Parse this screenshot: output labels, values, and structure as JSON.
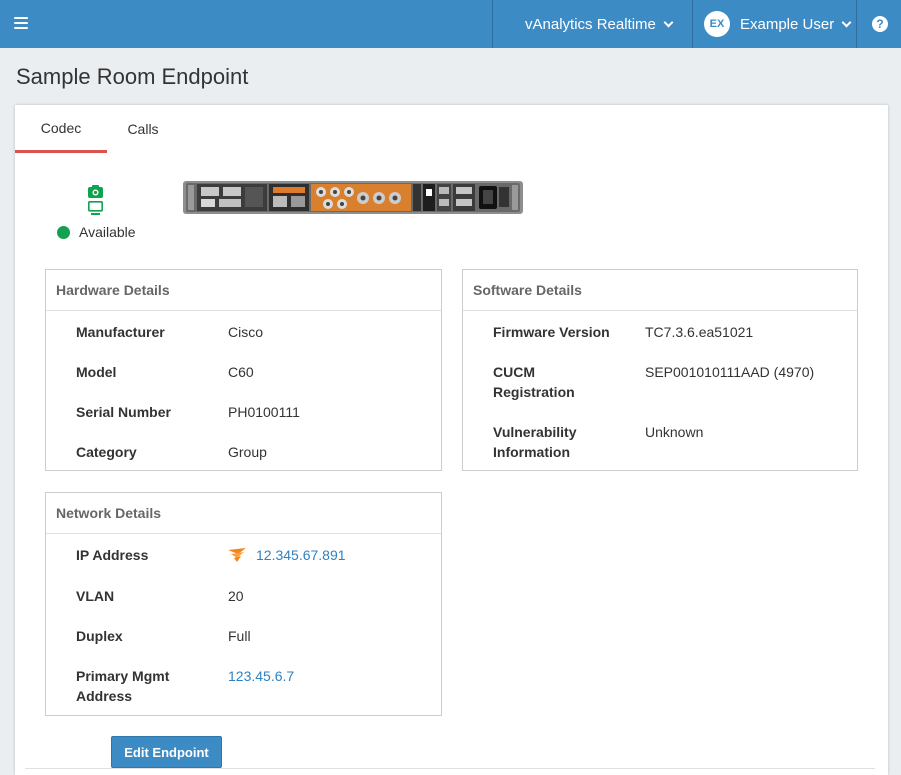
{
  "topbar": {
    "app_switcher": "vAnalytics Realtime",
    "user_initials": "EX",
    "user_name": "Example User",
    "help_symbol": "?"
  },
  "page": {
    "title": "Sample Room Endpoint"
  },
  "tabs": [
    {
      "label": "Codec",
      "active": true
    },
    {
      "label": "Calls",
      "active": false
    }
  ],
  "status": {
    "text": "Available",
    "color": "#12a14f"
  },
  "hardware": {
    "title": "Hardware Details",
    "rows": [
      {
        "label": "Manufacturer",
        "value": "Cisco"
      },
      {
        "label": "Model",
        "value": "C60"
      },
      {
        "label": "Serial Number",
        "value": "PH0100111"
      },
      {
        "label": "Category",
        "value": "Group"
      }
    ]
  },
  "software": {
    "title": "Software Details",
    "rows": [
      {
        "label": "Firmware Version",
        "value": "TC7.3.6.ea51021"
      },
      {
        "label": "CUCM\nRegistration",
        "value": "SEP001010111AAD (4970)"
      },
      {
        "label": "Vulnerability\nInformation",
        "value": "Unknown"
      }
    ]
  },
  "network": {
    "title": "Network Details",
    "rows": [
      {
        "label": "IP Address",
        "value": "12.345.67.891"
      },
      {
        "label": "VLAN",
        "value": "20"
      },
      {
        "label": "Duplex",
        "value": "Full"
      },
      {
        "label": "Primary Mgmt\nAddress",
        "value": "123.45.6.7"
      }
    ]
  },
  "actions": {
    "edit_label": "Edit Endpoint"
  },
  "colors": {
    "topbar": "#3d8bc4",
    "accent_tab": "#d9534f",
    "link": "#2f82c1"
  },
  "icons": [
    "menu-icon",
    "chevron-down-icon",
    "help-icon",
    "camera-icon",
    "monitor-icon",
    "solarwinds-icon"
  ]
}
